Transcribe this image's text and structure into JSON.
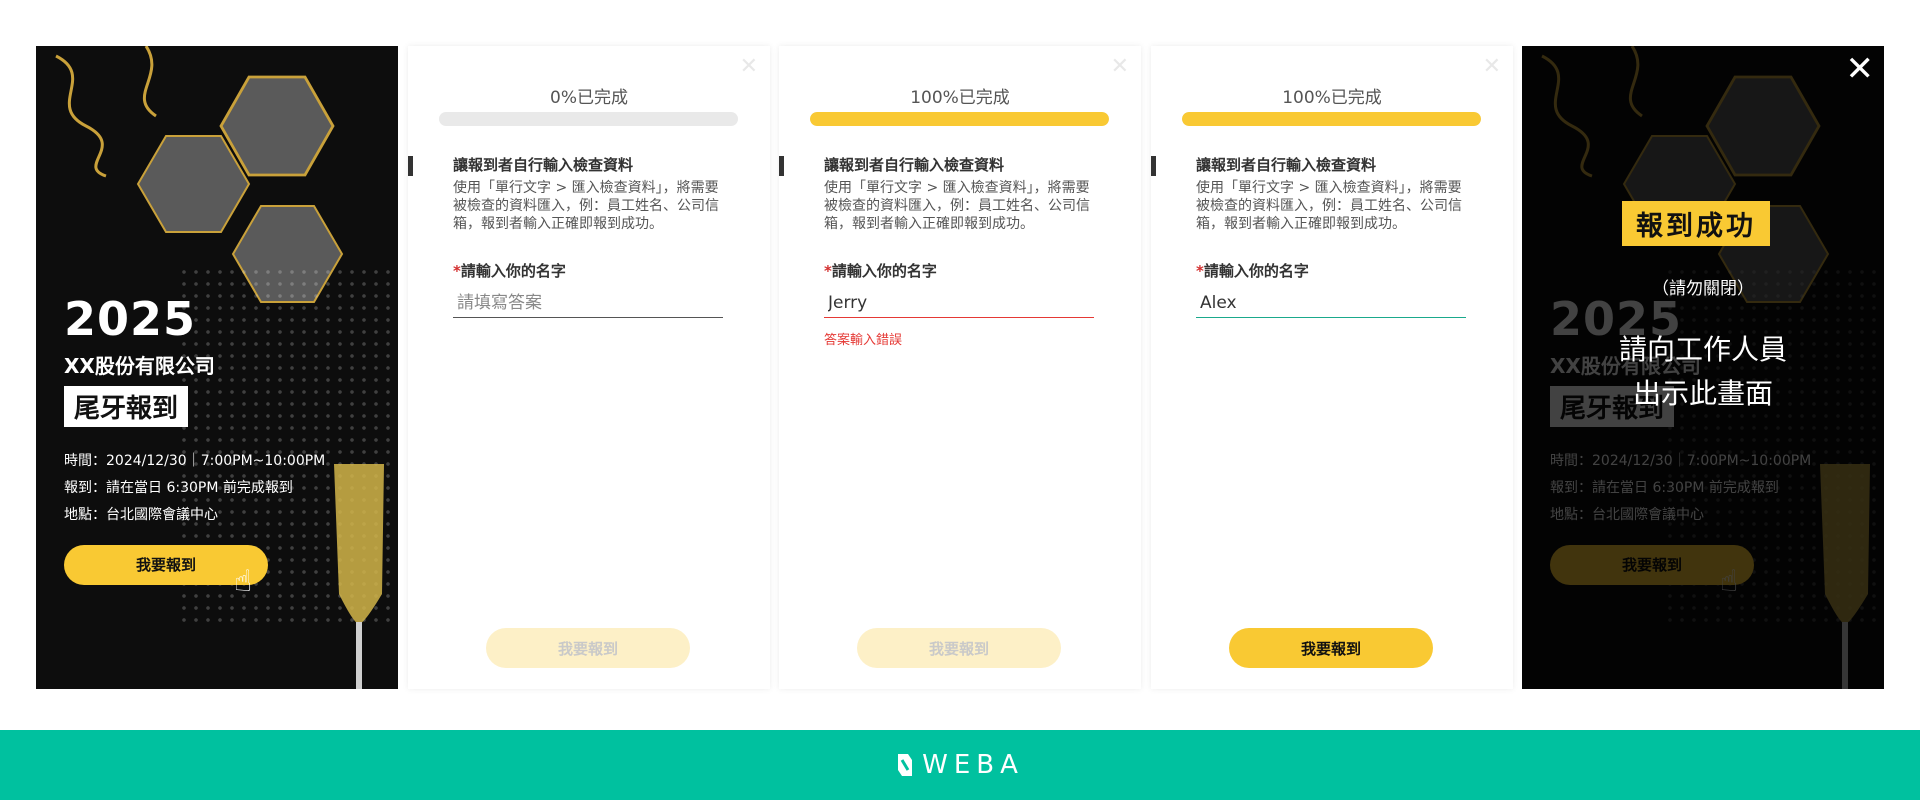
{
  "poster": {
    "year": "2025",
    "company": "XX股份有限公司",
    "tag": "尾牙報到",
    "info": [
      "時間：2024/12/30｜7:00PM~10:00PM",
      "報到：請在當日 6:30PM 前完成報到",
      "地點：台北國際會議中心"
    ],
    "button_label": "我要報到"
  },
  "forms": [
    {
      "progress_text": "0%已完成",
      "progress": 0,
      "question_title": "讓報到者自行輸入檢查資料",
      "question_desc": "使用「單行文字 > 匯入檢查資料」，將需要被檢查的資料匯入，例：員工姓名、公司信箱，報到者輸入正確即報到成功。",
      "required_mark": "*",
      "field_label": "請輸入你的名字",
      "field_value": "",
      "field_placeholder": "請填寫答案",
      "error_text": "",
      "submit_label": "我要報到",
      "submit_enabled": false
    },
    {
      "progress_text": "100%已完成",
      "progress": 100,
      "question_title": "讓報到者自行輸入檢查資料",
      "question_desc": "使用「單行文字 > 匯入檢查資料」，將需要被檢查的資料匯入，例：員工姓名、公司信箱，報到者輸入正確即報到成功。",
      "required_mark": "*",
      "field_label": "請輸入你的名字",
      "field_value": "Jerry",
      "field_placeholder": "",
      "error_text": "答案輸入錯誤",
      "submit_label": "我要報到",
      "submit_enabled": false
    },
    {
      "progress_text": "100%已完成",
      "progress": 100,
      "question_title": "讓報到者自行輸入檢查資料",
      "question_desc": "使用「單行文字 > 匯入檢查資料」，將需要被檢查的資料匯入，例：員工姓名、公司信箱，報到者輸入正確即報到成功。",
      "required_mark": "*",
      "field_label": "請輸入你的名字",
      "field_value": "Alex",
      "field_placeholder": "",
      "error_text": "",
      "submit_label": "我要報到",
      "submit_enabled": true
    }
  ],
  "success": {
    "badge": "報到成功",
    "note": "（請勿關閉）",
    "message_line1": "請向工作人員",
    "message_line2": "出示此畫面"
  },
  "footer": {
    "brand": "WEBA"
  },
  "colors": {
    "accent_yellow": "#f9c933",
    "brand_green": "#00c19f",
    "error_red": "#e53935",
    "poster_bg": "#0d0d0d"
  },
  "icons": [
    "close-icon",
    "hand-pointer-icon",
    "weba-logo-icon"
  ]
}
